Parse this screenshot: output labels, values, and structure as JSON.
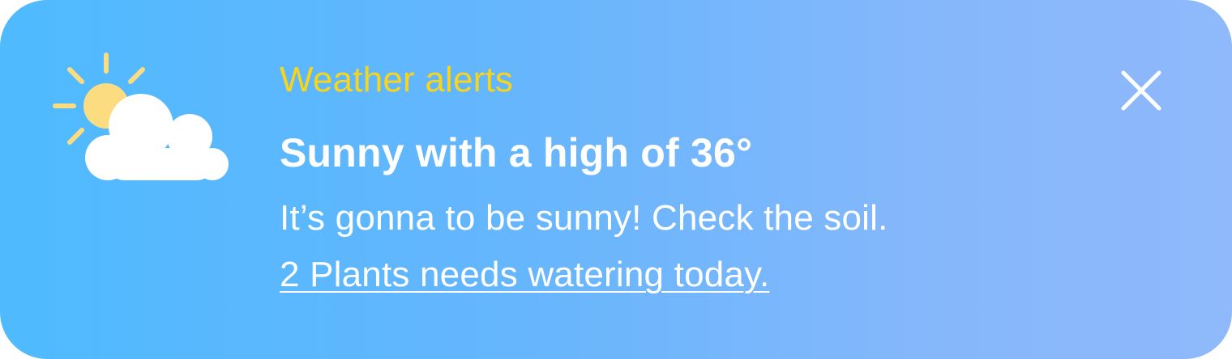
{
  "notification": {
    "category": "Weather alerts",
    "headline": "Sunny with a high of 36°",
    "message": "It’s gonna to be sunny! Check the soil.",
    "action_link": "2 Plants needs watering today."
  },
  "icons": {
    "weather": "sun-behind-cloud-icon",
    "close": "close-icon"
  },
  "colors": {
    "gradient_start": "#4fbafe",
    "gradient_end": "#8fb9fb",
    "category_text": "#f7d51c",
    "body_text": "#ffffff",
    "sun": "#fcdc80",
    "cloud": "#ffffff"
  }
}
